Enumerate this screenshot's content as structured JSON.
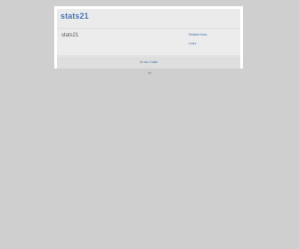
{
  "header": {
    "site_title": "stats21"
  },
  "main": {
    "text": "stats21"
  },
  "sidebar": {
    "links": [
      {
        "label": "Related links"
      },
      {
        "label": "Links"
      }
    ]
  },
  "footer": {
    "prefix": "Alt",
    "link": "rss 2 stats"
  },
  "below_text": "hpi",
  "colors": {
    "background": "#cfcfcf",
    "panel": "#e2e2e2",
    "title": "#4a76b5",
    "link": "#3b6fb6"
  }
}
